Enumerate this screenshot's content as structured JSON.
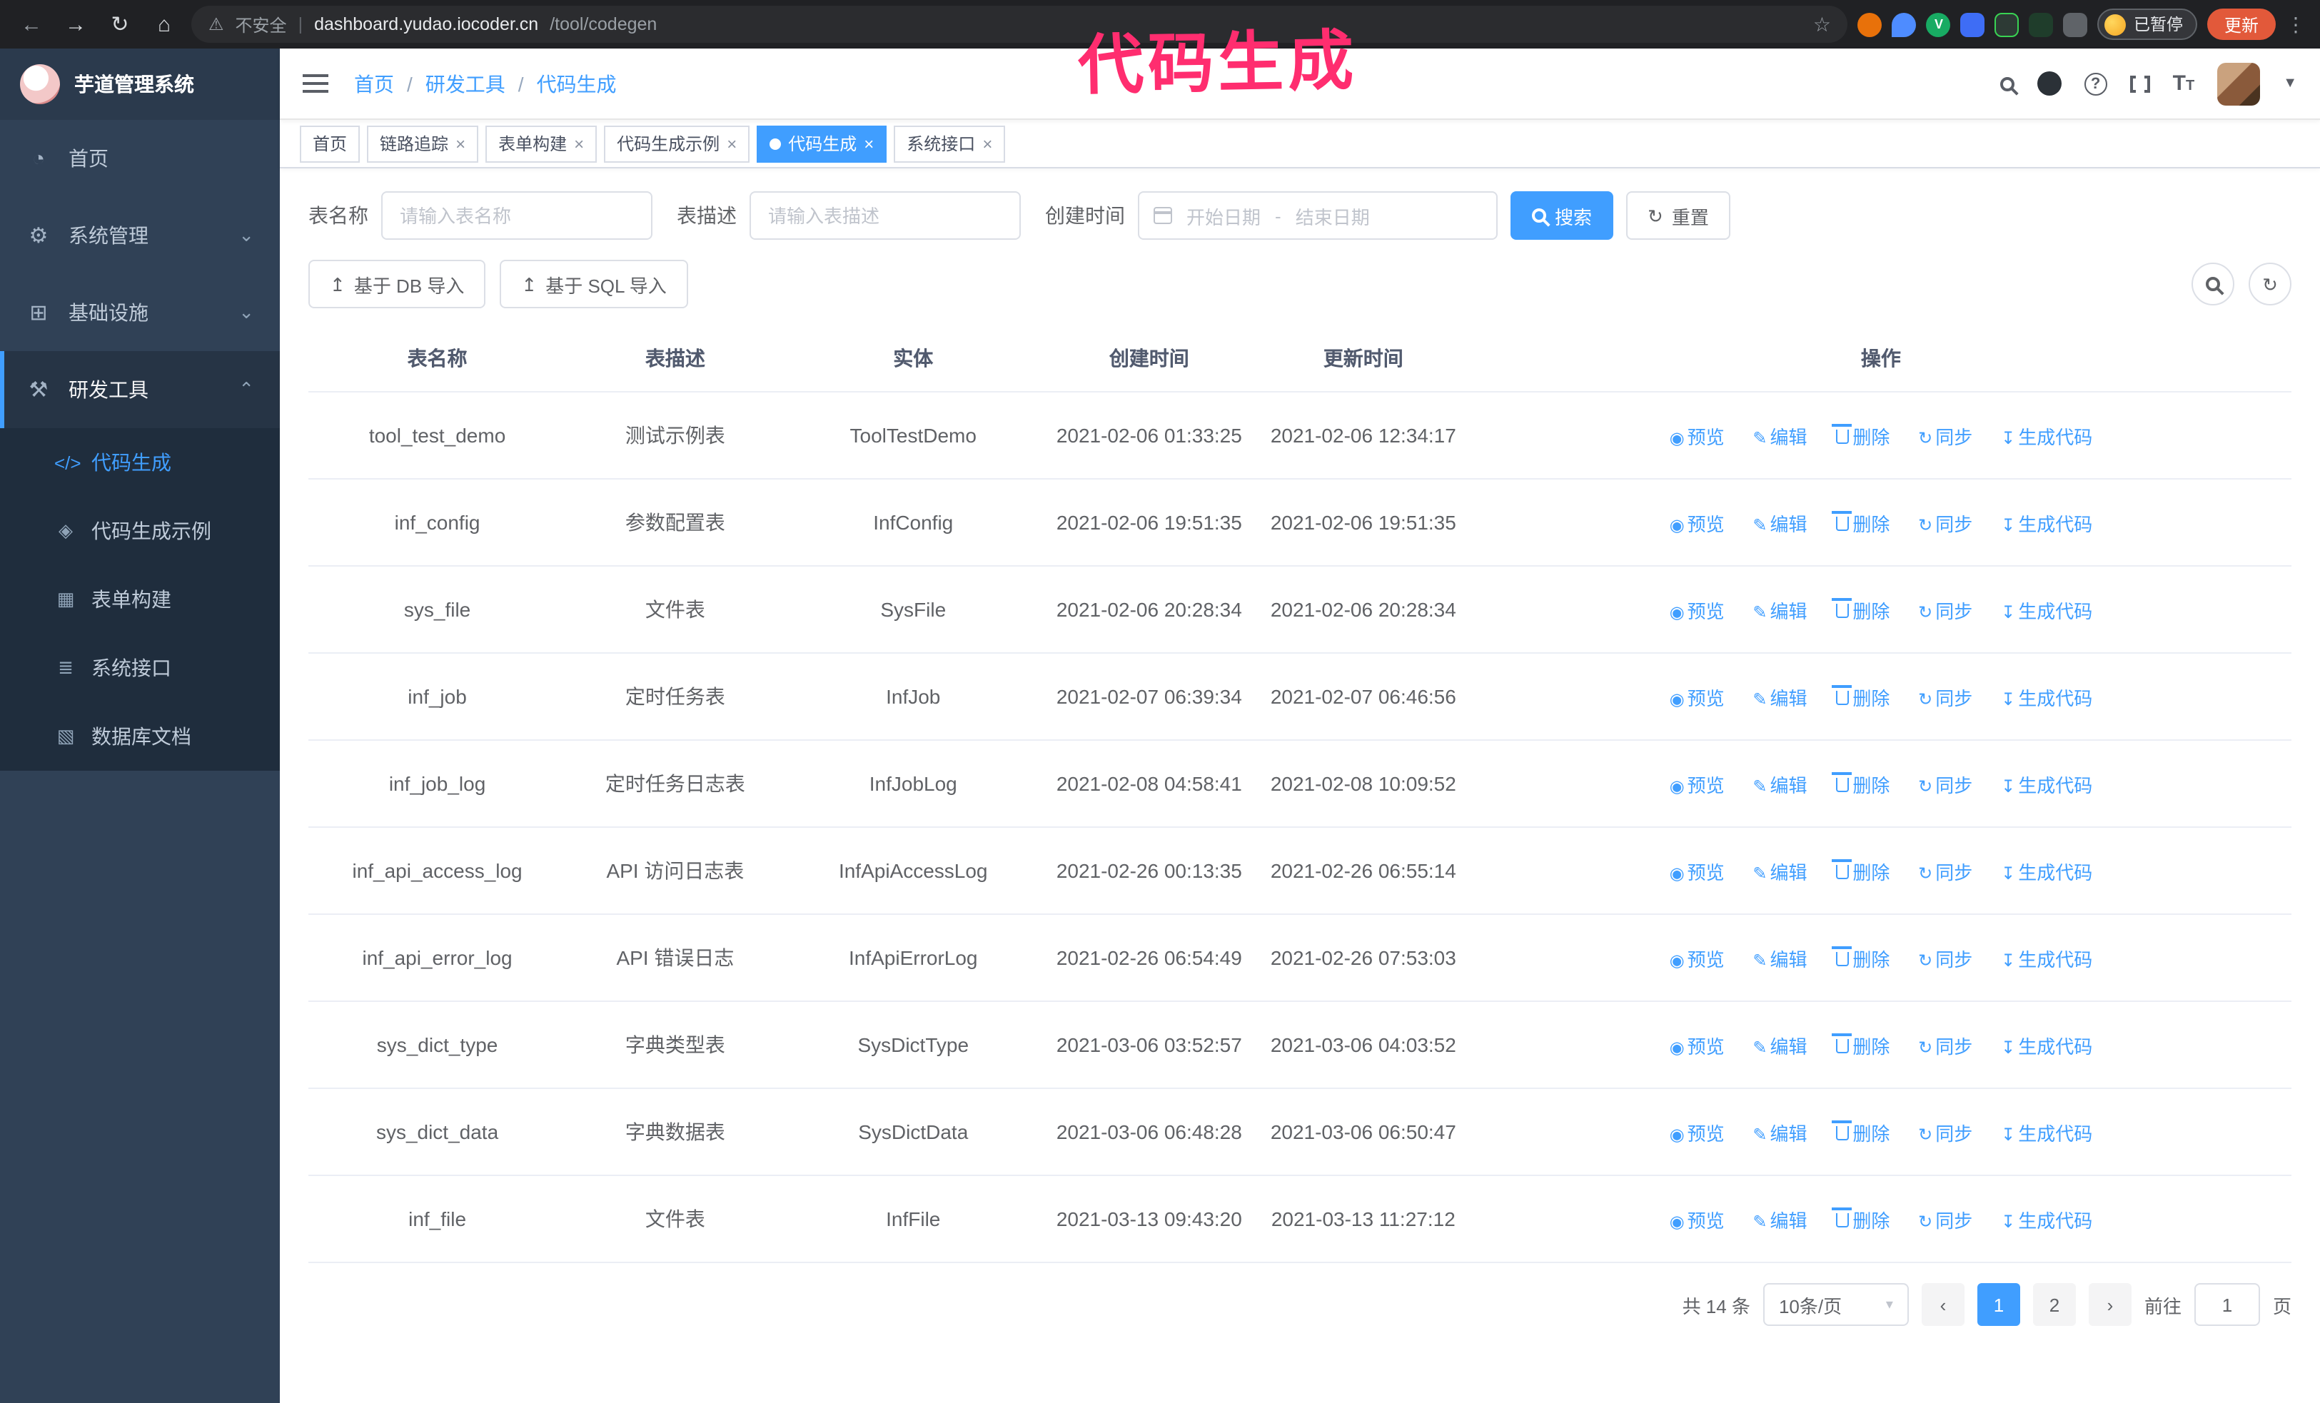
{
  "browser": {
    "back_tooltip": "back",
    "security_label": "不安全",
    "url_domain": "dashboard.yudao.iocoder.cn",
    "url_path": "/tool/codegen",
    "paused_badge": "已暂停",
    "update_button": "更新"
  },
  "annotation": "代码生成",
  "sidebar": {
    "title": "芋道管理系统",
    "items": [
      {
        "label": "首页",
        "expandable": false
      },
      {
        "label": "系统管理",
        "expandable": true
      },
      {
        "label": "基础设施",
        "expandable": true
      },
      {
        "label": "研发工具",
        "expandable": true,
        "expanded": true
      }
    ],
    "subitems": [
      {
        "label": "代码生成",
        "active": true
      },
      {
        "label": "代码生成示例"
      },
      {
        "label": "表单构建"
      },
      {
        "label": "系统接口"
      },
      {
        "label": "数据库文档"
      }
    ]
  },
  "breadcrumb": [
    "首页",
    "研发工具",
    "代码生成"
  ],
  "tabs": [
    {
      "label": "首页",
      "closable": false
    },
    {
      "label": "链路追踪",
      "closable": true
    },
    {
      "label": "表单构建",
      "closable": true
    },
    {
      "label": "代码生成示例",
      "closable": true
    },
    {
      "label": "代码生成",
      "closable": true,
      "active": true
    },
    {
      "label": "系统接口",
      "closable": true
    }
  ],
  "filters": {
    "table_name_label": "表名称",
    "table_name_placeholder": "请输入表名称",
    "table_desc_label": "表描述",
    "table_desc_placeholder": "请输入表描述",
    "create_time_label": "创建时间",
    "start_date_placeholder": "开始日期",
    "range_separator": "-",
    "end_date_placeholder": "结束日期",
    "search_button": "搜索",
    "reset_button": "重置"
  },
  "toolbar": {
    "import_db": "基于 DB 导入",
    "import_sql": "基于 SQL 导入"
  },
  "table": {
    "columns": [
      "表名称",
      "表描述",
      "实体",
      "创建时间",
      "更新时间",
      "操作"
    ],
    "ops": [
      "预览",
      "编辑",
      "删除",
      "同步",
      "生成代码"
    ],
    "rows": [
      {
        "name": "tool_test_demo",
        "desc": "测试示例表",
        "entity": "ToolTestDemo",
        "created": "2021-02-06 01:33:25",
        "updated": "2021-02-06 12:34:17"
      },
      {
        "name": "inf_config",
        "desc": "参数配置表",
        "entity": "InfConfig",
        "created": "2021-02-06 19:51:35",
        "updated": "2021-02-06 19:51:35"
      },
      {
        "name": "sys_file",
        "desc": "文件表",
        "entity": "SysFile",
        "created": "2021-02-06 20:28:34",
        "updated": "2021-02-06 20:28:34"
      },
      {
        "name": "inf_job",
        "desc": "定时任务表",
        "entity": "InfJob",
        "created": "2021-02-07 06:39:34",
        "updated": "2021-02-07 06:46:56"
      },
      {
        "name": "inf_job_log",
        "desc": "定时任务日志表",
        "entity": "InfJobLog",
        "created": "2021-02-08 04:58:41",
        "updated": "2021-02-08 10:09:52"
      },
      {
        "name": "inf_api_access_log",
        "desc": "API 访问日志表",
        "entity": "InfApiAccessLog",
        "created": "2021-02-26 00:13:35",
        "updated": "2021-02-26 06:55:14"
      },
      {
        "name": "inf_api_error_log",
        "desc": "API 错误日志",
        "entity": "InfApiErrorLog",
        "created": "2021-02-26 06:54:49",
        "updated": "2021-02-26 07:53:03"
      },
      {
        "name": "sys_dict_type",
        "desc": "字典类型表",
        "entity": "SysDictType",
        "created": "2021-03-06 03:52:57",
        "updated": "2021-03-06 04:03:52"
      },
      {
        "name": "sys_dict_data",
        "desc": "字典数据表",
        "entity": "SysDictData",
        "created": "2021-03-06 06:48:28",
        "updated": "2021-03-06 06:50:47"
      },
      {
        "name": "inf_file",
        "desc": "文件表",
        "entity": "InfFile",
        "created": "2021-03-13 09:43:20",
        "updated": "2021-03-13 11:27:12"
      }
    ]
  },
  "pagination": {
    "total": "共 14 条",
    "page_size": "10条/页",
    "pages": [
      "1",
      "2"
    ],
    "goto_label": "前往",
    "goto_value": "1",
    "goto_suffix": "页"
  },
  "colors": {
    "primary": "#409eff",
    "sidebar_bg": "#304156",
    "submenu_bg": "#1f2d3d",
    "annotation": "#ff2d6f",
    "browser_bar": "#202124",
    "update_button": "#e2593a"
  }
}
